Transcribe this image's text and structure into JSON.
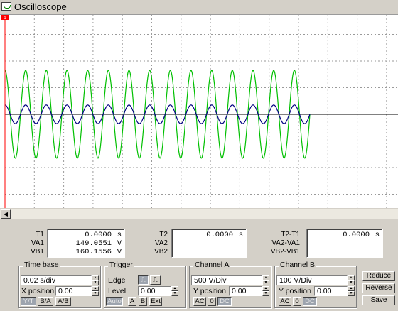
{
  "window": {
    "title": "Oscilloscope"
  },
  "trigger_marker": "1",
  "chart_data": {
    "type": "line",
    "title": "",
    "grid": true,
    "divisions": {
      "x": 10,
      "y": 8
    },
    "time_per_div": 0.02,
    "series": [
      {
        "channel": "A",
        "color": "#00c000",
        "amplitude_div": 1.65,
        "cycles": 14.75
      },
      {
        "channel": "B",
        "color": "#000080",
        "amplitude_div": 0.35,
        "cycles": 14.75
      }
    ]
  },
  "measurements": {
    "t1": {
      "label": "T1",
      "value": "0.0000",
      "unit": "s"
    },
    "va1": {
      "label": "VA1",
      "value": "149.0551",
      "unit": "V"
    },
    "vb1": {
      "label": "VB1",
      "value": "160.1556",
      "unit": "V"
    },
    "t2": {
      "label": "T2",
      "value": "0.0000",
      "unit": "s"
    },
    "va2": {
      "label": "VA2"
    },
    "vb2": {
      "label": "VB2"
    },
    "t2t1": {
      "label": "T2-T1",
      "value": "0.0000",
      "unit": "s"
    },
    "va2va1": {
      "label": "VA2-VA1"
    },
    "vb2vb1": {
      "label": "VB2-VB1"
    }
  },
  "timebase": {
    "title": "Time base",
    "scale": "0.02 s/div",
    "xpos_label": "X position",
    "xpos": "0.00",
    "buttons": [
      "Y/T",
      "B/A",
      "A/B"
    ]
  },
  "trigger": {
    "title": "Trigger",
    "edge_label": "Edge",
    "level_label": "Level",
    "level": "0.00",
    "buttons": [
      "Auto",
      "A",
      "B",
      "Ext"
    ]
  },
  "channel_a": {
    "title": "Channel A",
    "scale": "500  V/Div",
    "ypos_label": "Y position",
    "ypos": "0.00",
    "coupling": [
      "AC",
      "0",
      "DC"
    ]
  },
  "channel_b": {
    "title": "Channel B",
    "scale": "100  V/Div",
    "ypos_label": "Y position",
    "ypos": "0.00",
    "coupling": [
      "AC",
      "0",
      "DC"
    ]
  },
  "actions": {
    "reduce": "Reduce",
    "reverse": "Reverse",
    "save": "Save"
  }
}
